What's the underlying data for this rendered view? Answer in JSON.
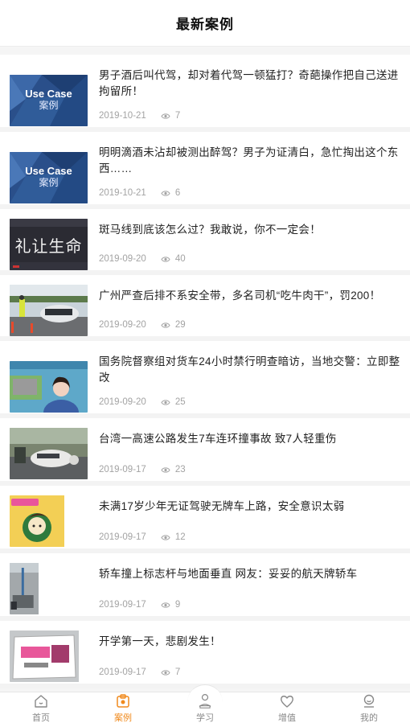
{
  "header": {
    "title": "最新案例"
  },
  "thumb_caption": {
    "en": "Use Case",
    "cn": "案例"
  },
  "articles": [
    {
      "title": "男子酒后叫代驾，却对着代驾一顿猛打？奇葩操作把自己送进拘留所！",
      "date": "2019-10-21",
      "views": "7",
      "thumb": "usecase"
    },
    {
      "title": "明明滴酒未沾却被测出醉驾？男子为证清白，急忙掏出这个东西……",
      "date": "2019-10-21",
      "views": "6",
      "thumb": "usecase"
    },
    {
      "title": "斑马线到底该怎么过？我敢说，你不一定会！",
      "date": "2019-09-20",
      "views": "40",
      "thumb": "road-text",
      "thumb_text": "礼让生命"
    },
    {
      "title": "广州严查后排不系安全带，多名司机“吃牛肉干”，罚200！",
      "date": "2019-09-20",
      "views": "29",
      "thumb": "traffic"
    },
    {
      "title": "国务院督察组对货车24小时禁行明查暗访，当地交警：立即整改",
      "date": "2019-09-20",
      "views": "25",
      "thumb": "news"
    },
    {
      "title": "台湾一高速公路发生7车连环撞事故 致7人轻重伤",
      "date": "2019-09-17",
      "views": "23",
      "thumb": "crash"
    },
    {
      "title": "未满17岁少年无证驾驶无牌车上路，安全意识太弱",
      "date": "2019-09-17",
      "views": "12",
      "thumb": "cartoon"
    },
    {
      "title": "轿车撞上标志杆与地面垂直 网友：妥妥的航天牌轿车",
      "date": "2019-09-17",
      "views": "9",
      "thumb": "pole"
    },
    {
      "title": "开学第一天，悲剧发生！",
      "date": "2019-09-17",
      "views": "7",
      "thumb": "school"
    }
  ],
  "tabbar": {
    "items": [
      {
        "label": "首页",
        "icon": "home-icon"
      },
      {
        "label": "案例",
        "icon": "case-icon",
        "active": true
      },
      {
        "label": "学习",
        "icon": "study-icon"
      },
      {
        "label": "增值",
        "icon": "heart-icon"
      },
      {
        "label": "我的",
        "icon": "profile-icon"
      }
    ]
  },
  "colors": {
    "accent": "#f08a1d",
    "meta": "#a3a3a3"
  }
}
